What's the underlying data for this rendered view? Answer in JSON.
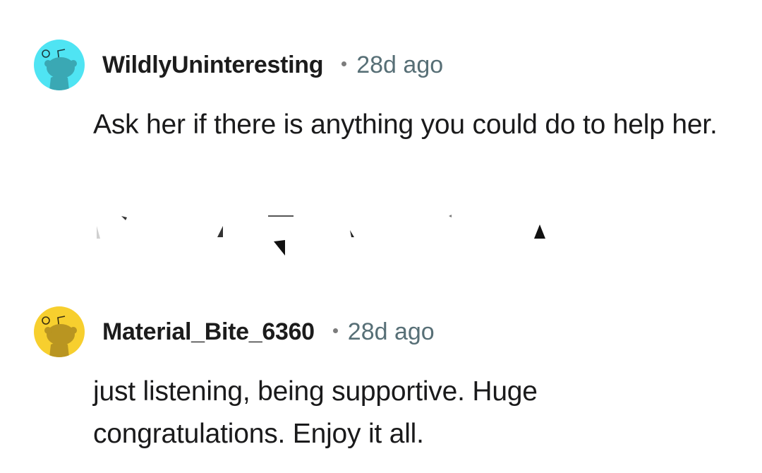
{
  "comments": [
    {
      "avatar_icon": "reddit-snoo-avatar-icon",
      "avatar_bg": "#4fe4f3",
      "avatar_fg": "#3aa8b4",
      "username": "WildlyUninteresting",
      "timestamp": "28d ago",
      "text": "Ask her if there is anything you could do to help her."
    },
    {
      "avatar_icon": "reddit-snoo-avatar-icon",
      "avatar_bg": "#f7cf2e",
      "avatar_fg": "#b99521",
      "username": "Material_Bite_6360",
      "timestamp": "28d ago",
      "text": "just listening, being supportive. Huge congratulations. Enjoy it all."
    }
  ]
}
